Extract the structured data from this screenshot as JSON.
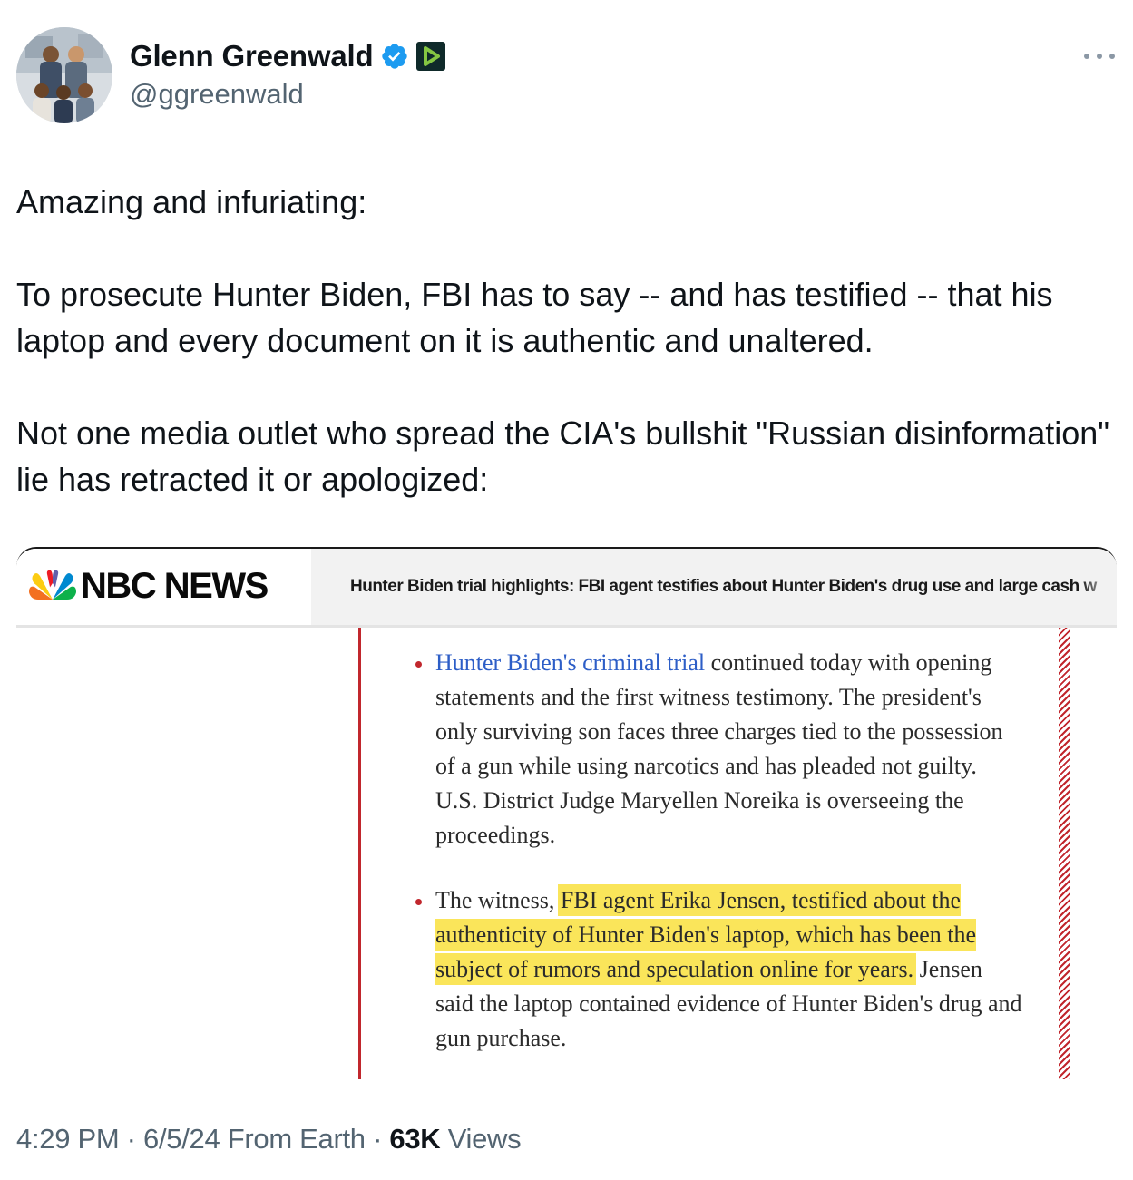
{
  "author": {
    "display_name": "Glenn Greenwald",
    "handle": "@ggreenwald",
    "verified_icon": "verified-badge-icon",
    "subscription_icon": "rumble-play-icon",
    "avatar_icon": "family-photo-avatar",
    "more_icon": "more-options-icon"
  },
  "tweet": {
    "paragraphs": [
      "Amazing and infuriating:",
      "To prosecute Hunter Biden, FBI has to say -- and has testified -- that his laptop and every document on it is authentic and unaltered.",
      "Not one media outlet who spread the CIA's bullshit \"Russian disinformation\" lie has retracted it or apologized:"
    ]
  },
  "media": {
    "logo_text": "NBC NEWS",
    "logo_icon": "nbc-peacock-icon",
    "headline": "Hunter Biden trial highlights: FBI agent testifies about Hunter Biden's drug use and large cash w",
    "bullets": [
      {
        "link_text": "Hunter Biden's criminal trial",
        "text": " continued today with opening statements and the first witness testimony. The president's only surviving son faces three charges tied to the possession of a gun while using narcotics and has pleaded not guilty. U.S. District Judge Maryellen Noreika is overseeing the proceedings."
      },
      {
        "lead": "The witness, ",
        "highlighted": "FBI agent Erika Jensen, testified about the authenticity of Hunter Biden's laptop, which has been the subject of rumors and speculation online for years.",
        "tail": " Jensen said the laptop contained evidence of Hunter Biden's drug and gun purchase."
      }
    ],
    "colors": {
      "accent_red": "#c1272d",
      "link_blue": "#2d5ec7",
      "highlight_yellow": "#fae55a"
    }
  },
  "meta": {
    "time": "4:29 PM",
    "separator": " · ",
    "date": "6/5/24",
    "source": " From Earth",
    "views_count": "63K",
    "views_label": " Views"
  },
  "colors": {
    "verified_blue": "#1d9bf0",
    "secondary_text": "#536471",
    "primary_text": "#0f1419"
  }
}
